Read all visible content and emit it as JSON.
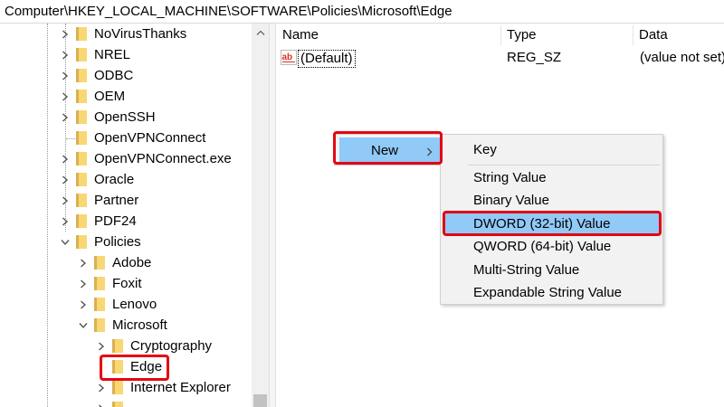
{
  "address_bar": {
    "path": "Computer\\HKEY_LOCAL_MACHINE\\SOFTWARE\\Policies\\Microsoft\\Edge"
  },
  "tree": {
    "items": [
      {
        "label": "NoVirusThanks",
        "expander": "collapsed"
      },
      {
        "label": "NREL",
        "expander": "collapsed"
      },
      {
        "label": "ODBC",
        "expander": "collapsed"
      },
      {
        "label": "OEM",
        "expander": "collapsed"
      },
      {
        "label": "OpenSSH",
        "expander": "collapsed"
      },
      {
        "label": "OpenVPNConnect",
        "expander": "none"
      },
      {
        "label": "OpenVPNConnect.exe",
        "expander": "collapsed"
      },
      {
        "label": "Oracle",
        "expander": "collapsed"
      },
      {
        "label": "Partner",
        "expander": "collapsed"
      },
      {
        "label": "PDF24",
        "expander": "collapsed"
      },
      {
        "label": "Policies",
        "expander": "expanded"
      },
      {
        "label": "Adobe",
        "expander": "collapsed"
      },
      {
        "label": "Foxit",
        "expander": "collapsed"
      },
      {
        "label": "Lenovo",
        "expander": "collapsed"
      },
      {
        "label": "Microsoft",
        "expander": "expanded"
      },
      {
        "label": "Cryptography",
        "expander": "collapsed"
      },
      {
        "label": "Edge",
        "expander": "none",
        "selected": true
      },
      {
        "label": "Internet Explorer",
        "expander": "collapsed"
      }
    ]
  },
  "list": {
    "columns": {
      "name": "Name",
      "type": "Type",
      "data": "Data"
    },
    "rows": [
      {
        "name": "(Default)",
        "type": "REG_SZ",
        "data": "(value not set)",
        "icon": "string-value-icon"
      }
    ]
  },
  "context_menu": {
    "new_label": "New",
    "submenu": [
      {
        "label": "Key"
      },
      {
        "label": "String Value"
      },
      {
        "label": "Binary Value"
      },
      {
        "label": "DWORD (32-bit) Value",
        "selected": true
      },
      {
        "label": "QWORD (64-bit) Value"
      },
      {
        "label": "Multi-String Value"
      },
      {
        "label": "Expandable String Value"
      }
    ]
  },
  "colors": {
    "highlight": "#91c9f7",
    "annotation_red": "#e30613",
    "folder_yellow": "#f8d775",
    "folder_dark": "#dcb052"
  }
}
